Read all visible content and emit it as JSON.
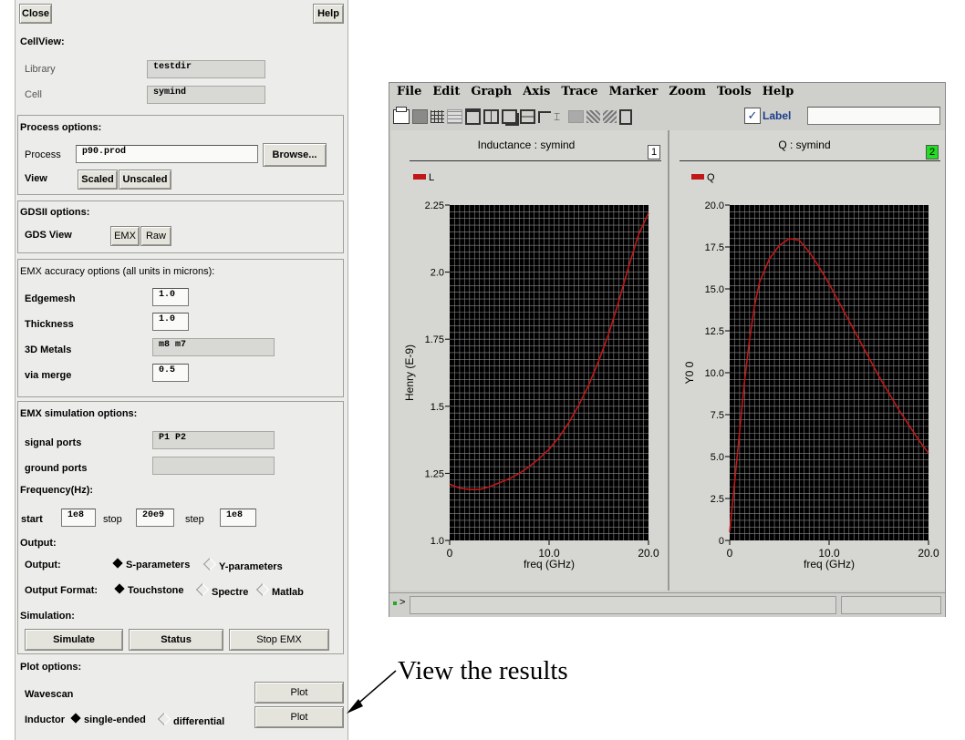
{
  "left_panel": {
    "close_label": "Close",
    "help_label": "Help",
    "cellview": {
      "heading": "CellView:",
      "library_label": "Library",
      "library_value": "testdir",
      "cell_label": "Cell",
      "cell_value": "symind"
    },
    "process": {
      "heading": "Process options:",
      "process_label": "Process",
      "process_value": "p90.prod",
      "browse_label": "Browse...",
      "view_label": "View",
      "scaled_label": "Scaled",
      "unscaled_label": "Unscaled"
    },
    "gdsii": {
      "heading": "GDSII options:",
      "gds_view_label": "GDS View",
      "emx_label": "EMX",
      "raw_label": "Raw"
    },
    "accuracy": {
      "heading": "EMX accuracy options (all units in microns):",
      "edgemesh_label": "Edgemesh",
      "edgemesh_value": "1.0",
      "thickness_label": "Thickness",
      "thickness_value": "1.0",
      "metals_label": "3D Metals",
      "metals_value": "m8 m7",
      "via_label": "via merge",
      "via_value": "0.5"
    },
    "simulation": {
      "heading": "EMX simulation options:",
      "signal_label": "signal ports",
      "signal_value": "P1 P2",
      "ground_label": "ground ports",
      "ground_value": "",
      "freq_heading": "Frequency(Hz):",
      "start_label": "start",
      "start_value": "1e8",
      "stop_label": "stop",
      "stop_value": "20e9",
      "step_label": "step",
      "step_value": "1e8",
      "output_heading": "Output:",
      "output_label": "Output:",
      "sparams_label": "S-parameters",
      "yparams_label": "Y-parameters",
      "format_label": "Output Format:",
      "touchstone_label": "Touchstone",
      "spectre_label": "Spectre",
      "matlab_label": "Matlab",
      "sim_heading": "Simulation:",
      "simulate_label": "Simulate",
      "status_label": "Status",
      "stop_emx_label": "Stop EMX"
    },
    "plot": {
      "heading": "Plot options:",
      "wavescan_label": "Wavescan",
      "plot_label": "Plot",
      "inductor_label": "Inductor",
      "single_label": "single-ended",
      "diff_label": "differential",
      "plot2_label": "Plot"
    }
  },
  "graph_window": {
    "menu": [
      "File",
      "Edit",
      "Graph",
      "Axis",
      "Trace",
      "Marker",
      "Zoom",
      "Tools",
      "Help"
    ],
    "label_checkbox": "Label",
    "prompt": ">"
  },
  "annotation": "View the results",
  "chart_data": [
    {
      "type": "line",
      "title": "Inductance : symind",
      "panel_number": "1",
      "legend": "L",
      "xlabel": "freq (GHz)",
      "ylabel": "Henry (E-9)",
      "xlim": [
        0,
        20
      ],
      "ylim": [
        1.0,
        2.25
      ],
      "x_ticks": [
        "0",
        "10.0",
        "20.0"
      ],
      "y_ticks": [
        "1.0",
        "1.25",
        "1.5",
        "1.75",
        "2.0",
        "2.25"
      ],
      "series": [
        {
          "name": "L",
          "color": "#c01818",
          "x": [
            0,
            1,
            2,
            3,
            4,
            5,
            6,
            7,
            8,
            9,
            10,
            11,
            12,
            13,
            14,
            15,
            16,
            17,
            18,
            19,
            20
          ],
          "y": [
            1.21,
            1.195,
            1.19,
            1.19,
            1.2,
            1.215,
            1.23,
            1.25,
            1.275,
            1.305,
            1.34,
            1.385,
            1.44,
            1.505,
            1.58,
            1.67,
            1.77,
            1.89,
            2.02,
            2.14,
            2.22
          ]
        }
      ]
    },
    {
      "type": "line",
      "title": "Q : symind",
      "panel_number": "2",
      "legend": "Q",
      "xlabel": "freq (GHz)",
      "ylabel": "Y0 0",
      "xlim": [
        0,
        20
      ],
      "ylim": [
        0,
        20
      ],
      "x_ticks": [
        "0",
        "10.0",
        "20.0"
      ],
      "y_ticks": [
        "0",
        "2.5",
        "5.0",
        "7.5",
        "10.0",
        "12.5",
        "15.0",
        "17.5",
        "20.0"
      ],
      "series": [
        {
          "name": "Q",
          "color": "#c01818",
          "x": [
            0,
            0.5,
            1,
            1.5,
            2,
            2.5,
            3,
            4,
            5,
            6,
            7,
            8,
            9,
            10,
            11,
            12,
            13,
            14,
            15,
            16,
            17,
            18,
            19,
            20
          ],
          "y": [
            0.5,
            3.5,
            6.5,
            9.5,
            12,
            14,
            15.4,
            16.8,
            17.6,
            18.0,
            17.9,
            17.2,
            16.3,
            15.3,
            14.2,
            13.1,
            12.0,
            10.9,
            9.8,
            8.8,
            7.8,
            6.9,
            6.0,
            5.2
          ]
        }
      ]
    }
  ]
}
